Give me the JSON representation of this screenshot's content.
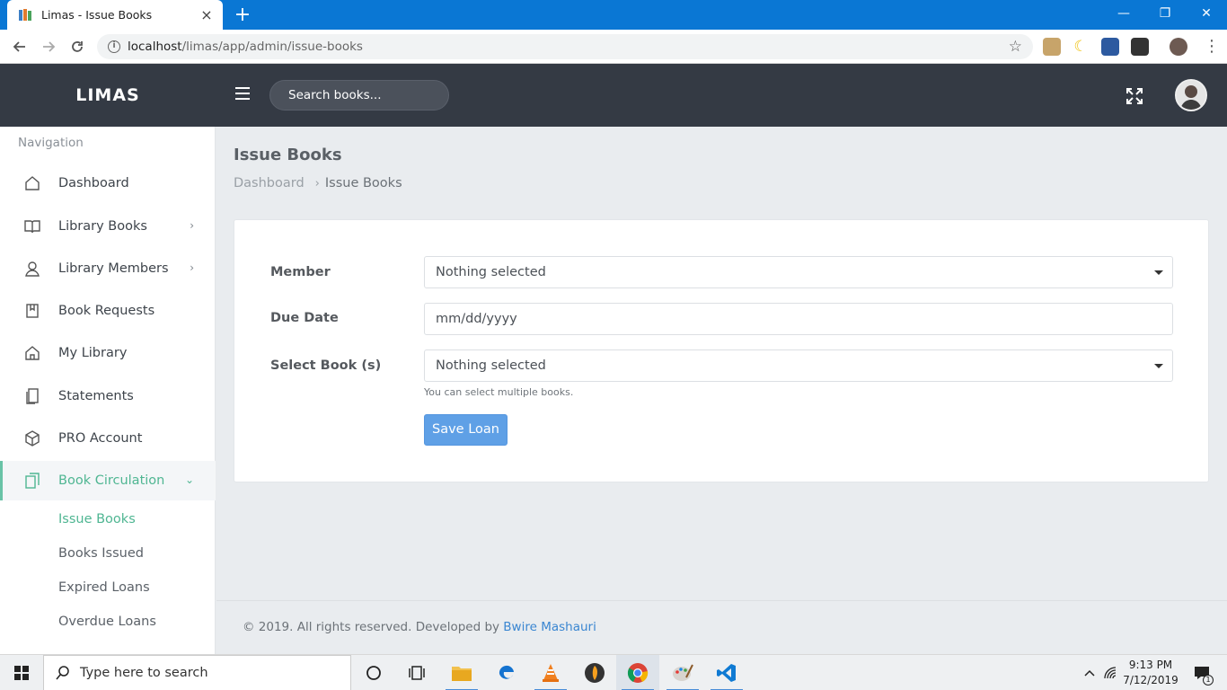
{
  "browser": {
    "tab_title": "Limas - Issue Books",
    "url_host": "localhost",
    "url_path": "/limas/app/admin/issue-books",
    "new_tab_label": "+",
    "minimize_label": "—",
    "restore_label": "❐",
    "close_label": "✕",
    "tab_close_label": "×"
  },
  "header": {
    "brand": "LIMAS",
    "search_placeholder": "Search books..."
  },
  "sidebar": {
    "heading": "Navigation",
    "items": [
      {
        "label": "Dashboard",
        "icon": "home-icon"
      },
      {
        "label": "Library Books",
        "icon": "book-icon",
        "has_children": true
      },
      {
        "label": "Library Members",
        "icon": "user-icon",
        "has_children": true
      },
      {
        "label": "Book Requests",
        "icon": "bookmark-book-icon"
      },
      {
        "label": "My Library",
        "icon": "home-icon"
      },
      {
        "label": "Statements",
        "icon": "statement-icon"
      },
      {
        "label": "PRO Account",
        "icon": "box-icon"
      },
      {
        "label": "Book Circulation",
        "icon": "copy-icon",
        "expanded": true
      }
    ],
    "sub_items": [
      {
        "label": "Issue Books",
        "current": true
      },
      {
        "label": "Books Issued"
      },
      {
        "label": "Expired Loans"
      },
      {
        "label": "Overdue Loans"
      }
    ]
  },
  "page": {
    "title": "Issue Books",
    "breadcrumb": {
      "home": "Dashboard",
      "separator": "›",
      "current": "Issue Books"
    }
  },
  "form": {
    "member_label": "Member",
    "member_value": "Nothing selected",
    "due_date_label": "Due Date",
    "due_date_placeholder": "mm/dd/yyyy",
    "books_label": "Select Book (s)",
    "books_value": "Nothing selected",
    "books_help": "You can select multiple books.",
    "save_label": "Save Loan"
  },
  "footer": {
    "text": "© 2019. All rights reserved. Developed by ",
    "author": "Bwire Mashauri"
  },
  "taskbar": {
    "search_placeholder": "Type here to search",
    "time": "9:13 PM",
    "date": "7/12/2019",
    "notification_count": "1"
  },
  "colors": {
    "accent_green": "#4fb692",
    "header_dark": "#343a44",
    "button_blue": "#5fa0e6",
    "browser_blue": "#0a77d4"
  }
}
